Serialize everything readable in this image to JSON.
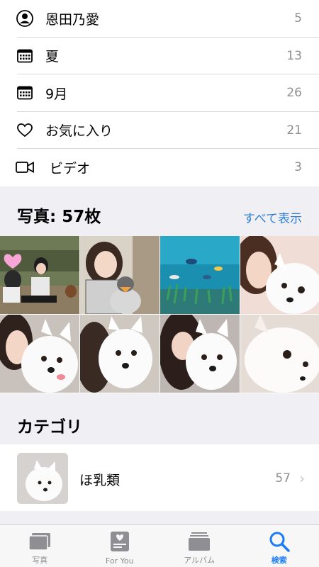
{
  "people_places_list": [
    {
      "icon": "person-icon",
      "label": "恩田乃愛",
      "count": "5"
    },
    {
      "icon": "calendar-icon",
      "label": "夏",
      "count": "13"
    },
    {
      "icon": "calendar-icon",
      "label": "9月",
      "count": "26"
    },
    {
      "icon": "heart-icon",
      "label": "お気に入り",
      "count": "21"
    },
    {
      "icon": "video-camera-icon",
      "label": "ビデオ",
      "count": "3"
    }
  ],
  "photos_section": {
    "title": "写真: 57枚",
    "see_all": "すべて表示"
  },
  "category_section": {
    "title": "カテゴリ",
    "item_label": "ほ乳類",
    "item_count": "57"
  },
  "tabbar": {
    "tabs": [
      {
        "label": "写真",
        "icon": "photos-icon"
      },
      {
        "label": "For You",
        "icon": "for-you-icon"
      },
      {
        "label": "アルバム",
        "icon": "albums-icon"
      },
      {
        "label": "検索",
        "icon": "search-icon",
        "active": true
      }
    ]
  },
  "colors": {
    "accent": "#2f7fd6",
    "active_tab": "#1a7cf5",
    "secondary_text": "#8e8e93",
    "background": "#efeff4"
  }
}
